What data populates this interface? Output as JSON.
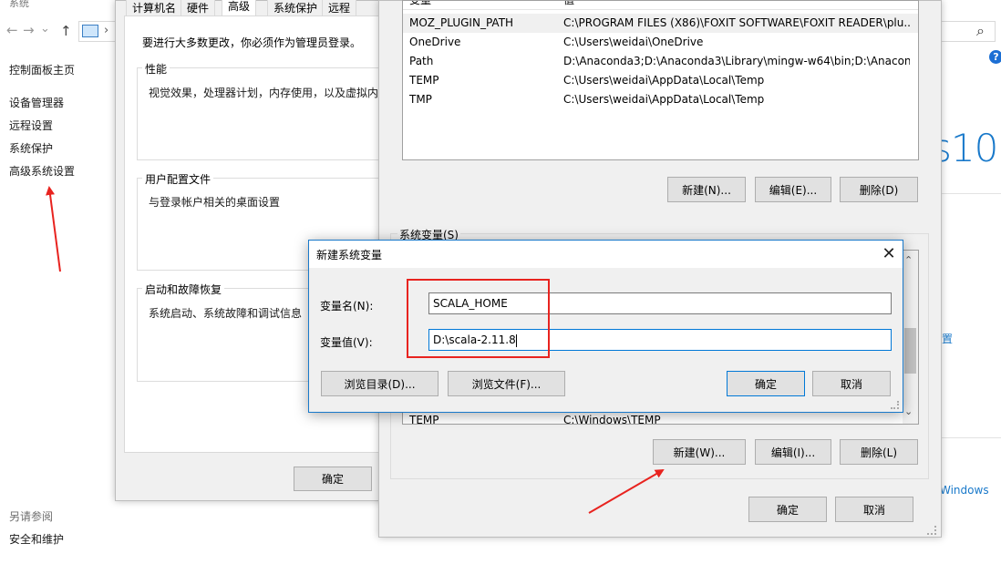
{
  "system_window": {
    "title": "系统",
    "nav": {
      "back": "←",
      "forward": "→",
      "dropdown": "⌄",
      "up": "↑",
      "chevron": "›"
    },
    "search_icon": "⌕",
    "help": "?",
    "sidebar": {
      "home": "控制面板主页",
      "items": [
        {
          "label": "设备管理器"
        },
        {
          "label": "远程设置"
        },
        {
          "label": "系统保护"
        },
        {
          "label": "高级系统设置"
        }
      ],
      "see_also_title": "另请参阅",
      "see_also": [
        {
          "label": "安全和维护"
        }
      ]
    },
    "brand_fragment": "s10",
    "right_link_fragment": "置",
    "windows_link_fragment": "Windows"
  },
  "props_dialog": {
    "tabs": [
      {
        "label": "计算机名"
      },
      {
        "label": "硬件"
      },
      {
        "label": "高级",
        "active": true
      },
      {
        "label": "系统保护"
      },
      {
        "label": "远程"
      }
    ],
    "admin_note": "要进行大多数更改，你必须作为管理员登录。",
    "groups": [
      {
        "title": "性能",
        "text": "视觉效果，处理器计划，内存使用，以及虚拟内"
      },
      {
        "title": "用户配置文件",
        "text": "与登录帐户相关的桌面设置"
      },
      {
        "title": "启动和故障恢复",
        "text": "系统启动、系统故障和调试信息"
      }
    ],
    "ok_label": "确定"
  },
  "env_dialog": {
    "user_list": {
      "columns": [
        "变量",
        "值"
      ],
      "rows": [
        {
          "name": "MOZ_PLUGIN_PATH",
          "value": "C:\\PROGRAM FILES (X86)\\FOXIT SOFTWARE\\FOXIT READER\\plu...",
          "selected": true
        },
        {
          "name": "OneDrive",
          "value": "C:\\Users\\weidai\\OneDrive"
        },
        {
          "name": "Path",
          "value": "D:\\Anaconda3;D:\\Anaconda3\\Library\\mingw-w64\\bin;D:\\Anacon..."
        },
        {
          "name": "TEMP",
          "value": "C:\\Users\\weidai\\AppData\\Local\\Temp"
        },
        {
          "name": "TMP",
          "value": "C:\\Users\\weidai\\AppData\\Local\\Temp"
        }
      ]
    },
    "user_buttons": {
      "new": "新建(N)...",
      "edit": "编辑(E)...",
      "delete": "删除(D)"
    },
    "system_group_title": "系统变量(S)",
    "system_list": {
      "rows": [
        {
          "name": "TEMP",
          "value": "C:\\Windows\\TEMP"
        }
      ]
    },
    "scroll_up": "⌃",
    "scroll_down": "⌄",
    "system_buttons": {
      "new": "新建(W)...",
      "edit": "编辑(I)...",
      "delete": "删除(L)"
    },
    "ok_label": "确定",
    "cancel_label": "取消"
  },
  "new_var_dialog": {
    "title": "新建系统变量",
    "close": "✕",
    "name_label": "变量名(N):",
    "name_value": "SCALA_HOME",
    "value_label": "变量值(V):",
    "value_value": "D:\\scala-2.11.8",
    "browse_dir": "浏览目录(D)...",
    "browse_file": "浏览文件(F)...",
    "ok_label": "确定",
    "cancel_label": "取消"
  },
  "colors": {
    "accent": "#0078d7",
    "annotation_red": "#e8231f",
    "link_blue": "#1979ca"
  }
}
